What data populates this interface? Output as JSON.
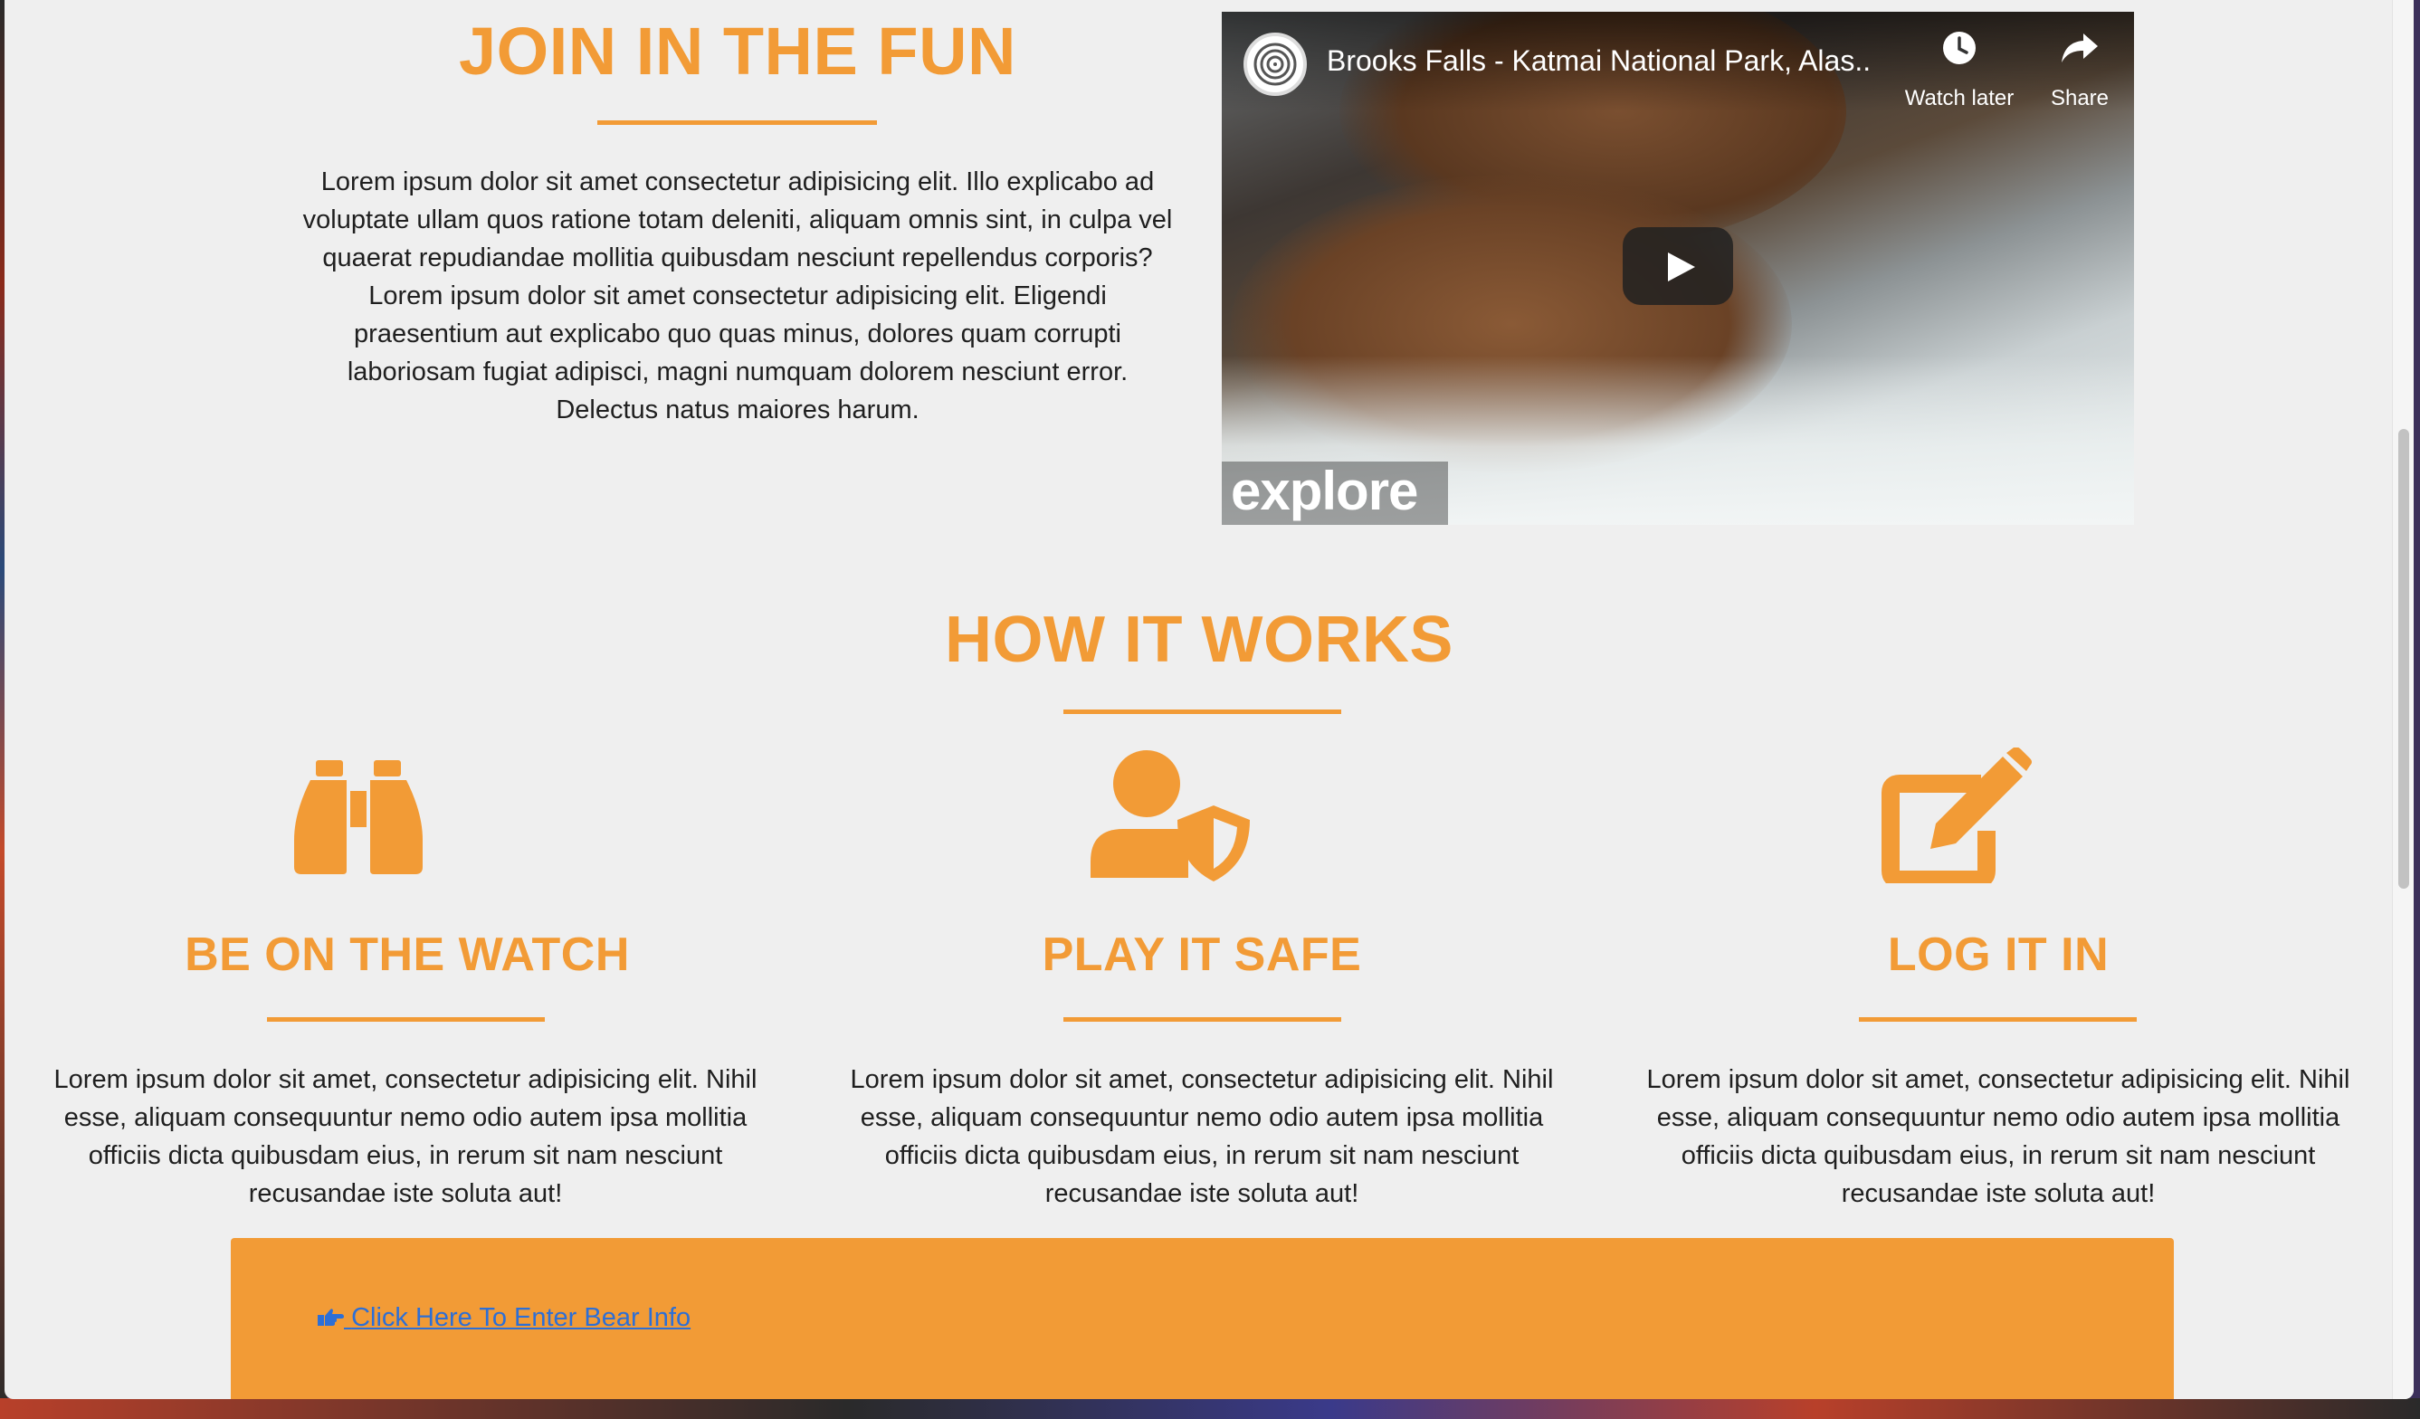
{
  "join": {
    "title": "JOIN IN THE FUN",
    "text": "Lorem ipsum dolor sit amet consectetur adipisicing elit. Illo explicabo ad voluptate ullam quos ratione totam deleniti, aliquam omnis sint, in culpa vel quaerat repudiandae mollitia quibusdam nesciunt repellendus corporis? Lorem ipsum dolor sit amet consectetur adipisicing elit. Eligendi praesentium aut explicabo quo quas minus, dolores quam corrupti laboriosam fugiat adipisci, magni numquam dolorem nesciunt error. Delectus natus maiores harum."
  },
  "video": {
    "title": "Brooks Falls - Katmai National Park, Alas...",
    "watch_later": "Watch later",
    "share": "Share",
    "brand": "explore"
  },
  "how": {
    "title": "HOW IT WORKS",
    "columns": [
      {
        "icon": "binoculars-icon",
        "title": "BE ON THE WATCH",
        "text": "Lorem ipsum dolor sit amet, consectetur adipisicing elit. Nihil esse, aliquam consequuntur nemo odio autem ipsa mollitia officiis dicta quibusdam eius, in rerum sit nam nesciunt recusandae iste soluta aut!"
      },
      {
        "icon": "user-shield-icon",
        "title": "PLAY IT SAFE",
        "text": "Lorem ipsum dolor sit amet, consectetur adipisicing elit. Nihil esse, aliquam consequuntur nemo odio autem ipsa mollitia officiis dicta quibusdam eius, in rerum sit nam nesciunt recusandae iste soluta aut!"
      },
      {
        "icon": "edit-icon",
        "title": "LOG IT IN",
        "text": "Lorem ipsum dolor sit amet, consectetur adipisicing elit. Nihil esse, aliquam consequuntur nemo odio autem ipsa mollitia officiis dicta quibusdam eius, in rerum sit nam nesciunt recusandae iste soluta aut!"
      }
    ]
  },
  "banner": {
    "link_text": "Click Here To Enter Bear Info",
    "link_icon": "hand-point-right-icon"
  },
  "colors": {
    "accent": "#f29b36",
    "page_bg": "#efefef",
    "link": "#2d6fd6"
  }
}
